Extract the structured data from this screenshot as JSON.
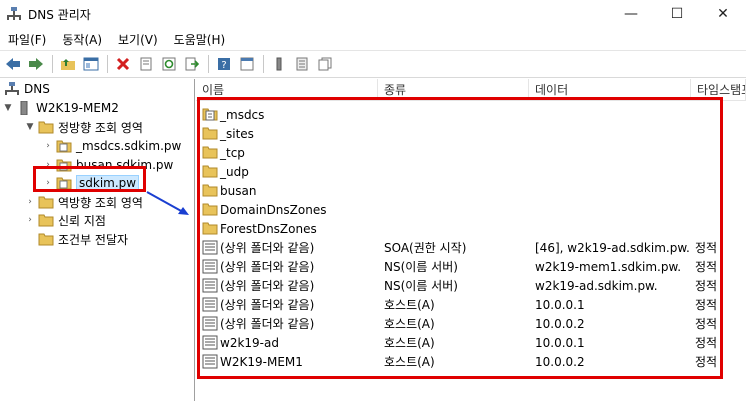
{
  "window": {
    "title": "DNS 관리자",
    "minimize": "—",
    "maximize": "☐",
    "close": "✕"
  },
  "menu": [
    "파일(F)",
    "동작(A)",
    "보기(V)",
    "도움말(H)"
  ],
  "toolbar_icons": [
    "back-icon",
    "forward-icon",
    "up-folder-icon",
    "show-tree-icon",
    "delete-icon",
    "properties-icon",
    "refresh-icon",
    "export-icon",
    "help-icon",
    "console-icon",
    "server-icon",
    "list-icon",
    "copy-icon"
  ],
  "tree": {
    "root": "DNS",
    "server": "W2K19-MEM2",
    "forward_zones": "정방향 조회 영역",
    "zones": [
      "_msdcs.sdkim.pw",
      "busan.sdkim.pw",
      "sdkim.pw"
    ],
    "reverse_zones": "역방향 조회 영역",
    "trust_points": "신뢰 지점",
    "conditional_forwarders": "조건부 전달자"
  },
  "columns": [
    "이름",
    "종류",
    "데이터",
    "타임스탬프"
  ],
  "rows": [
    {
      "name": "_msdcs",
      "type": "",
      "data": "",
      "ts": "",
      "icon": "zone-icon"
    },
    {
      "name": "_sites",
      "type": "",
      "data": "",
      "ts": "",
      "icon": "folder-icon"
    },
    {
      "name": "_tcp",
      "type": "",
      "data": "",
      "ts": "",
      "icon": "folder-icon"
    },
    {
      "name": "_udp",
      "type": "",
      "data": "",
      "ts": "",
      "icon": "folder-icon"
    },
    {
      "name": "busan",
      "type": "",
      "data": "",
      "ts": "",
      "icon": "folder-icon"
    },
    {
      "name": "DomainDnsZones",
      "type": "",
      "data": "",
      "ts": "",
      "icon": "folder-icon"
    },
    {
      "name": "ForestDnsZones",
      "type": "",
      "data": "",
      "ts": "",
      "icon": "folder-icon"
    },
    {
      "name": "(상위 폴더와 같음)",
      "type": "SOA(권한 시작)",
      "data": "[46], w2k19-ad.sdkim.pw...",
      "ts": "정적",
      "icon": "record-icon"
    },
    {
      "name": "(상위 폴더와 같음)",
      "type": "NS(이름 서버)",
      "data": "w2k19-mem1.sdkim.pw.",
      "ts": "정적",
      "icon": "record-icon"
    },
    {
      "name": "(상위 폴더와 같음)",
      "type": "NS(이름 서버)",
      "data": "w2k19-ad.sdkim.pw.",
      "ts": "정적",
      "icon": "record-icon"
    },
    {
      "name": "(상위 폴더와 같음)",
      "type": "호스트(A)",
      "data": "10.0.0.1",
      "ts": "정적",
      "icon": "record-icon"
    },
    {
      "name": "(상위 폴더와 같음)",
      "type": "호스트(A)",
      "data": "10.0.0.2",
      "ts": "정적",
      "icon": "record-icon"
    },
    {
      "name": "w2k19-ad",
      "type": "호스트(A)",
      "data": "10.0.0.1",
      "ts": "정적",
      "icon": "record-icon"
    },
    {
      "name": "W2K19-MEM1",
      "type": "호스트(A)",
      "data": "10.0.0.2",
      "ts": "정적",
      "icon": "record-icon"
    }
  ],
  "colors": {
    "highlight": "#e00000",
    "arrow": "#1a3fd1",
    "folder": "#e8c35a"
  }
}
